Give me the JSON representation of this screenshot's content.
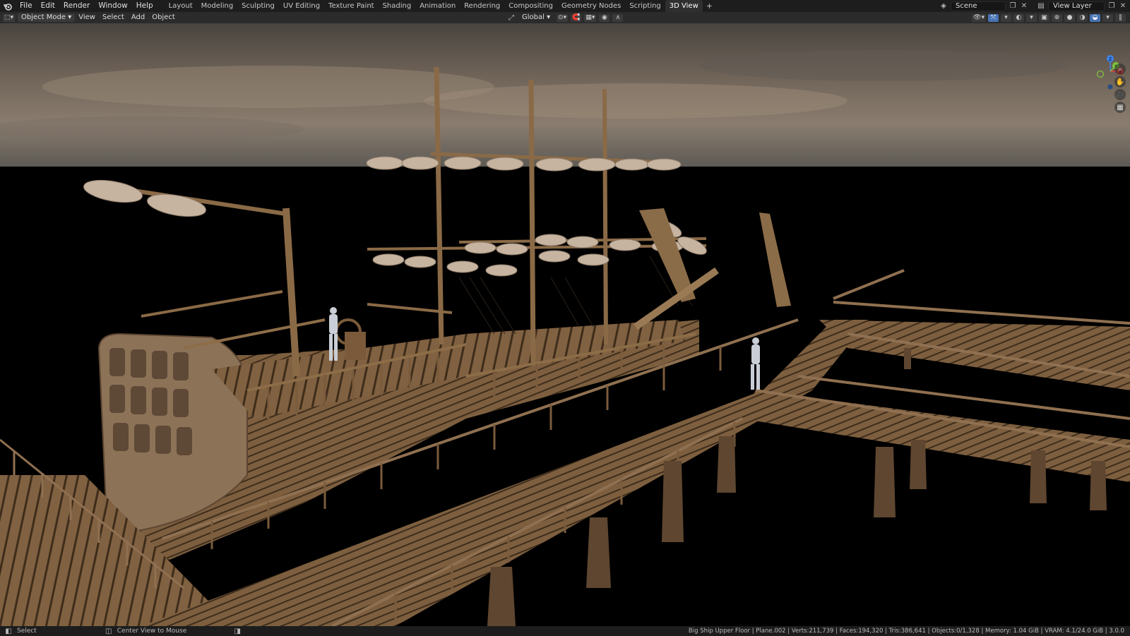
{
  "topbar": {
    "menus": [
      "File",
      "Edit",
      "Render",
      "Window",
      "Help"
    ],
    "workspaces": [
      "Layout",
      "Modeling",
      "Sculpting",
      "UV Editing",
      "Texture Paint",
      "Shading",
      "Animation",
      "Rendering",
      "Compositing",
      "Geometry Nodes",
      "Scripting",
      "3D View"
    ],
    "active_workspace": "3D View",
    "add_tab": "+",
    "scene_name": "Scene",
    "view_layer": "View Layer"
  },
  "header": {
    "mode": "Object Mode",
    "menus": [
      "View",
      "Select",
      "Add",
      "Object"
    ],
    "transform_orientation": "Global"
  },
  "gizmo": {
    "axes": [
      "Z",
      "Y",
      "X"
    ],
    "colors": {
      "x": "#e8403a",
      "y": "#7dc63d",
      "z": "#3d82e8"
    }
  },
  "statusbar": {
    "left_action": "Select",
    "middle_action": "Center View to Mouse",
    "stats": "Big Ship Upper Floor | Plane.002 | Verts:211,739 | Faces:194,320 | Tris:386,641 | Objects:0/1,328 | Memory: 1.04 GiB | VRAM: 4.1/24.0 GiB | 3.0.0"
  },
  "colors": {
    "wood": "#8b6a45",
    "wood_dark": "#4a3522",
    "sky_top": "#4f4a44",
    "active_blue": "#4772b3"
  }
}
